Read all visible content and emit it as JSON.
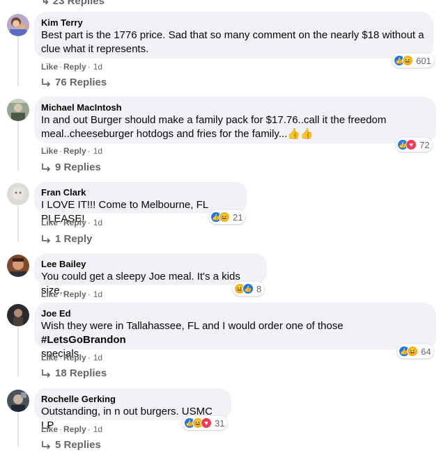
{
  "top_replies_label": "23 Replies",
  "action_like": "Like",
  "action_reply": "Reply",
  "action_dot": "·",
  "comments": [
    {
      "author": "Kim Terry",
      "text_lines": [
        "Best part is the 1776 price. Sad that so many comment on the nearly $18 without a",
        "clue what it represents."
      ],
      "reactions": [
        "like",
        "haha"
      ],
      "reaction_count": "601",
      "time": "1d",
      "replies": "76 Replies",
      "avatar_color": "#6b5a8e"
    },
    {
      "author": "Michael MacIntosh",
      "text_lines": [
        "In and out Burger should make a family pack for $17.76..call it the freedom",
        "meal..cheeseburger hotdogs and fries for the family...👍👍"
      ],
      "reactions": [
        "like",
        "love"
      ],
      "reaction_count": "72",
      "time": "1d",
      "replies": "9 Replies",
      "avatar_color": "#7a8a74"
    },
    {
      "author": "Fran Clark",
      "text_lines": [
        "I LOVE IT!!! Come to Melbourne, FL PLEASE!"
      ],
      "reactions": [
        "like",
        "haha"
      ],
      "reaction_count": "21",
      "time": "1d",
      "replies": "1 Reply",
      "avatar_color": "#c9cbc4"
    },
    {
      "author": "Lee Bailey",
      "text_lines": [
        "You could get a sleepy Joe meal. It's a kids size.."
      ],
      "reactions": [
        "haha",
        "like"
      ],
      "reaction_count": "8",
      "time": "1d",
      "replies": "",
      "avatar_color": "#a0593a"
    },
    {
      "author": "Joe Ed",
      "text_lines": [
        "Wish they were in Tallahassee, FL and I would order one of those ",
        "specials."
      ],
      "hashtag": "#LetsGoBrandon",
      "reactions": [
        "like",
        "haha"
      ],
      "reaction_count": "64",
      "time": "1d",
      "replies": "18 Replies",
      "avatar_color": "#3c3a40"
    },
    {
      "author": "Rochelle Gerking",
      "text_lines": [
        "Outstanding, in n out burgers. USMC LP"
      ],
      "reactions": [
        "like",
        "haha",
        "love"
      ],
      "reaction_count": "31",
      "time": "1d",
      "replies": "5 Replies",
      "avatar_color": "#55606a"
    }
  ]
}
